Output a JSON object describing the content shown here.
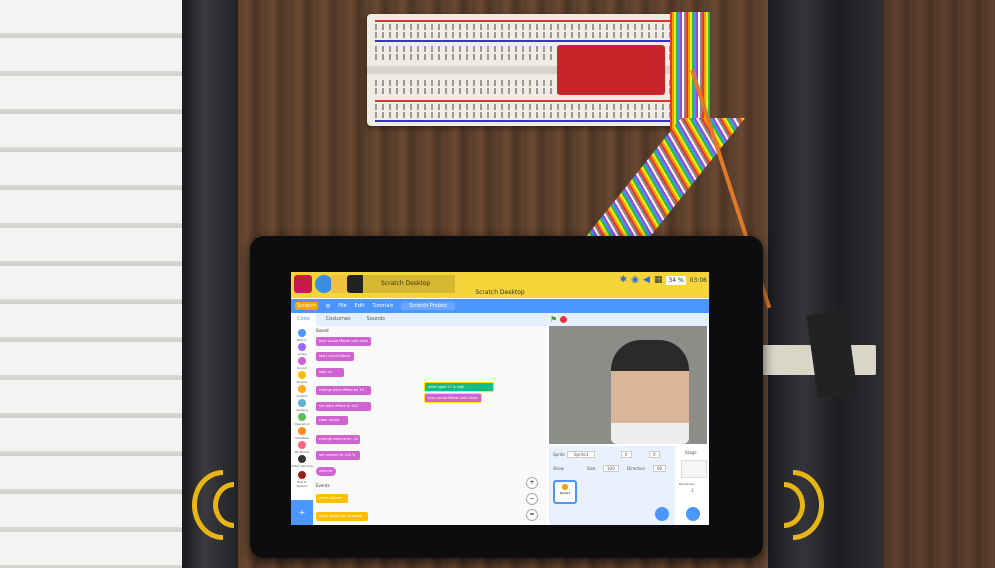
{
  "desktop": {
    "taskbar_window_title": "Scratch Desktop",
    "window_title": "Scratch Desktop",
    "volume": "34 %",
    "clock": "03:06"
  },
  "scratch": {
    "menu": {
      "logo": "Scratch",
      "file": "File",
      "edit": "Edit",
      "tutorials": "Tutorials",
      "project": "Scratch Project"
    },
    "tabs": [
      "Code",
      "Costumes",
      "Sounds"
    ],
    "categories": [
      "Motion",
      "Looks",
      "Sound",
      "Events",
      "Control",
      "Sensing",
      "Operators",
      "Variables",
      "My Blocks",
      "Video Sensing",
      "Text to Speech"
    ],
    "palette_heading_sound": "Sound",
    "palette_heading_events": "Events",
    "palette_blocks": [
      "play sound Meow until done",
      "start sound Meow",
      "stop all sounds",
      "change pitch effect by 10",
      "set pitch effect to 100",
      "clear sound effects",
      "change volume by -10",
      "set volume to 100 %",
      "volume",
      "when clicked",
      "when space key pressed"
    ],
    "script_blocks": [
      "when gpio 17 is high",
      "play sound Meow until done"
    ],
    "sprite_info": {
      "sprite_label": "Sprite",
      "sprite_name": "Sprite1",
      "x": "0",
      "y": "0",
      "show_label": "Show",
      "size_label": "Size",
      "size": "100",
      "direction_label": "Direction",
      "direction": "90"
    },
    "sprite_thumb": "Sprite1",
    "stage_label": "Stage",
    "backdrops_label": "Backdrops",
    "backdrops_count": "1"
  },
  "colors": {
    "scratch_blue": "#4c97ff",
    "sound_purple": "#cf63cf",
    "events_yellow": "#ffbf00",
    "taskbar_yellow": "#f4d53a",
    "wave_yellow": "#e8b614"
  }
}
